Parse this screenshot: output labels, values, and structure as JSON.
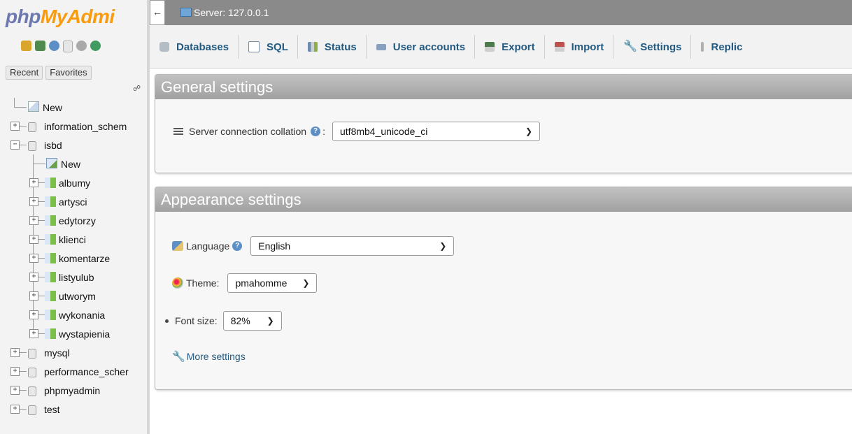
{
  "nav": {
    "logo_php": "php",
    "logo_myadmin": "MyAdmi",
    "tabs": [
      "Recent",
      "Favorites"
    ],
    "tree": [
      {
        "label": "New",
        "kind": "new",
        "level": 0
      },
      {
        "label": "information_schem",
        "kind": "db",
        "level": 0
      },
      {
        "label": "isbd",
        "kind": "db",
        "level": 0,
        "expanded": true
      },
      {
        "label": "New",
        "kind": "new",
        "level": 1
      },
      {
        "label": "albumy",
        "kind": "table",
        "level": 1
      },
      {
        "label": "artysci",
        "kind": "table",
        "level": 1
      },
      {
        "label": "edytorzy",
        "kind": "table",
        "level": 1
      },
      {
        "label": "klienci",
        "kind": "table",
        "level": 1
      },
      {
        "label": "komentarze",
        "kind": "table",
        "level": 1
      },
      {
        "label": "listyulub",
        "kind": "table",
        "level": 1
      },
      {
        "label": "utworym",
        "kind": "table",
        "level": 1
      },
      {
        "label": "wykonania",
        "kind": "table",
        "level": 1
      },
      {
        "label": "wystapienia",
        "kind": "table",
        "level": 1
      },
      {
        "label": "mysql",
        "kind": "db",
        "level": 0
      },
      {
        "label": "performance_scher",
        "kind": "db",
        "level": 0
      },
      {
        "label": "phpmyadmin",
        "kind": "db",
        "level": 0
      },
      {
        "label": "test",
        "kind": "db",
        "level": 0
      }
    ]
  },
  "topbar": {
    "collapse_glyph": "←",
    "server_label": "Server: 127.0.0.1"
  },
  "menu": [
    {
      "label": "Databases",
      "icon": "database-icon",
      "color": "#9aa4ad"
    },
    {
      "label": "SQL",
      "icon": "sql-icon",
      "color": "#7a8aa0"
    },
    {
      "label": "Status",
      "icon": "status-icon",
      "color": "#6b8bb0"
    },
    {
      "label": "User accounts",
      "icon": "user-accounts-icon",
      "color": "#8aa0c0"
    },
    {
      "label": "Export",
      "icon": "export-icon",
      "color": "#4d7a4d"
    },
    {
      "label": "Import",
      "icon": "import-icon",
      "color": "#c05050"
    },
    {
      "label": "Settings",
      "icon": "wrench-icon",
      "color": "#8a8a8a"
    },
    {
      "label": "Replic",
      "icon": "replication-icon",
      "color": "#9a9a9a"
    }
  ],
  "general": {
    "title": "General settings",
    "collation_label": "Server connection collation",
    "collation_suffix": ":",
    "collation_value": "utf8mb4_unicode_ci"
  },
  "appearance": {
    "title": "Appearance settings",
    "language_label": "Language",
    "language_value": "English",
    "theme_label": "Theme:",
    "theme_value": "pmahomme",
    "fontsize_label": "Font size:",
    "fontsize_value": "82%",
    "more_settings": "More settings"
  }
}
